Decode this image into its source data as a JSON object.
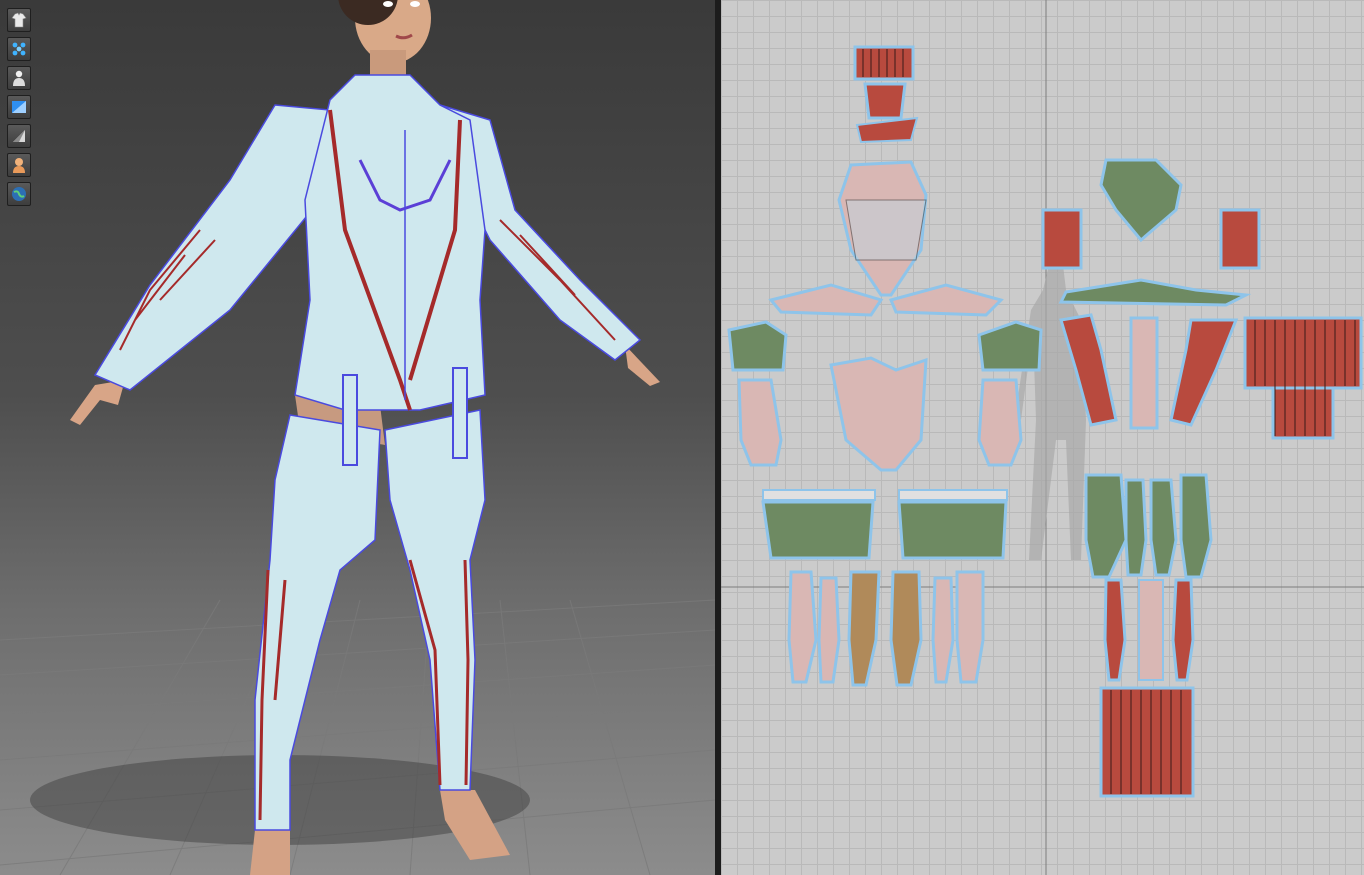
{
  "app": {
    "view_3d": {
      "toolbar": [
        {
          "icon": "garment-icon"
        },
        {
          "icon": "particle-icon"
        },
        {
          "icon": "avatar-icon"
        },
        {
          "icon": "texture-icon"
        },
        {
          "icon": "shading-icon"
        },
        {
          "icon": "skin-icon"
        },
        {
          "icon": "environment-icon"
        }
      ]
    },
    "view_2d": {}
  },
  "colors": {
    "fabric_light": "#cfe8ee",
    "topstitch_red": "#a52a2a",
    "seam_blue": "#4a4adf",
    "pattern_green": "#6e8a62",
    "pattern_pink": "#d9b7b4",
    "pattern_tan": "#b08a5a",
    "grid_bg": "#cbcbcb"
  }
}
